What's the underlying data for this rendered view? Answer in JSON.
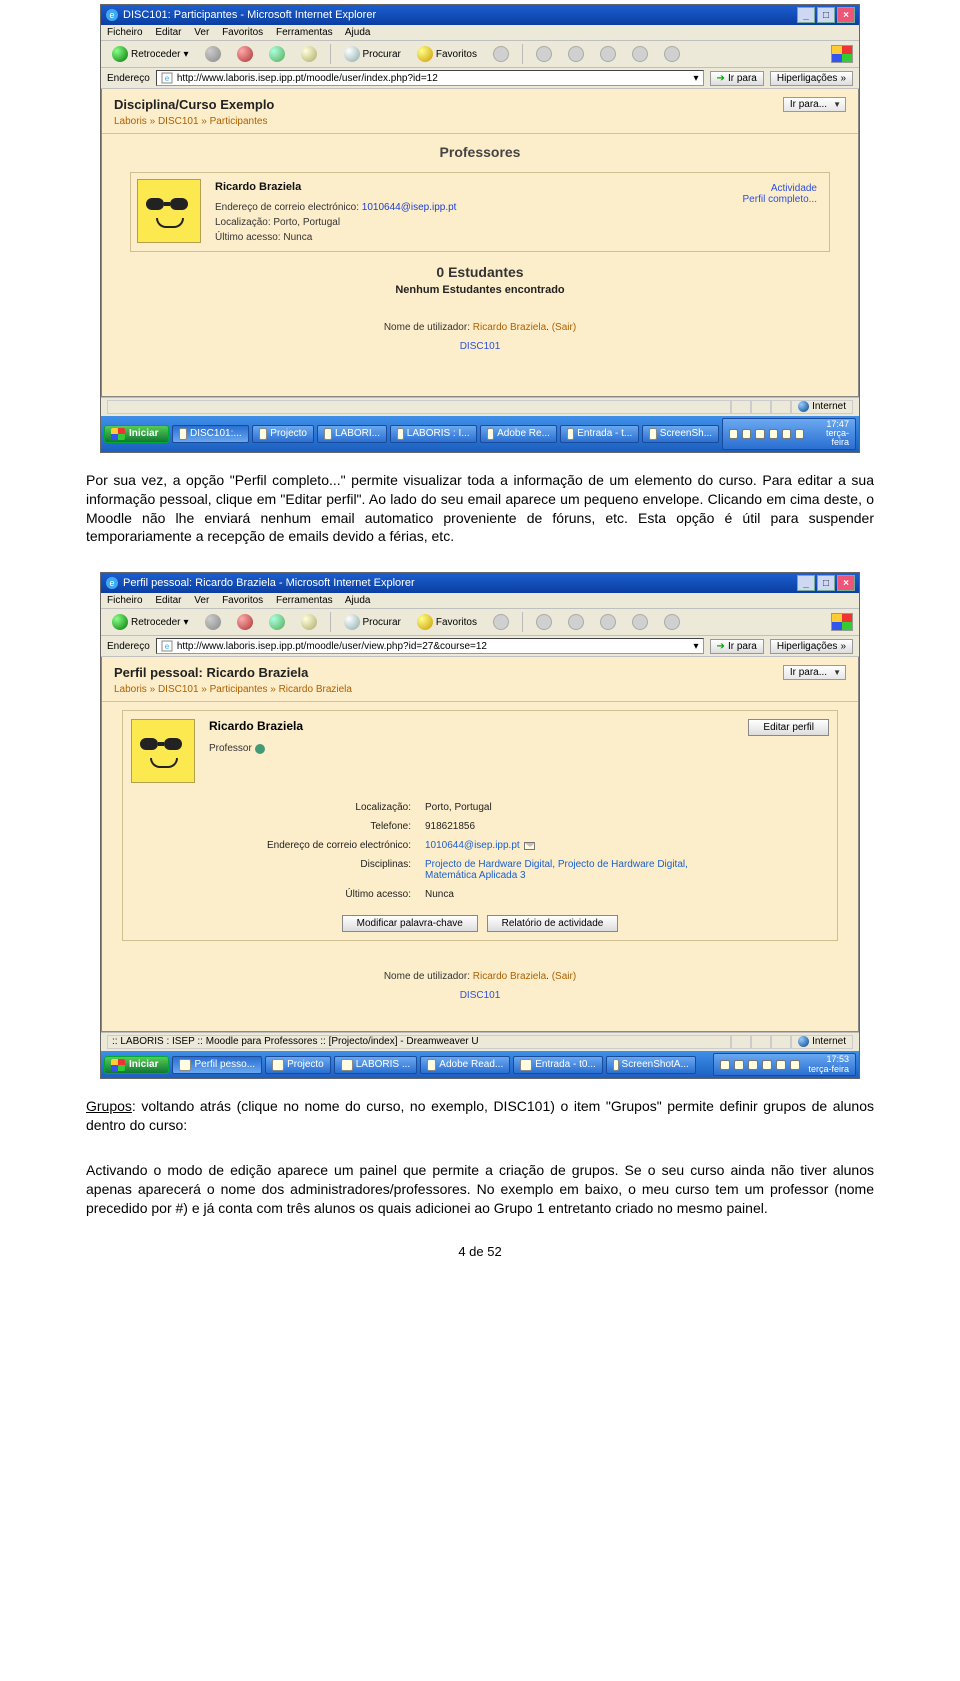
{
  "page_number": "4 de 52",
  "para1": "Por sua vez, a opção \"Perfil completo...\" permite visualizar toda a informação de um elemento do curso. Para editar a sua informação pessoal, clique em \"Editar perfil\". Ao lado do seu email aparece um pequeno envelope. Clicando em cima deste, o Moodle não lhe enviará nenhum email automatico proveniente de fóruns, etc. Esta opção é útil para suspender temporariamente a recepção de emails devido a férias, etc.",
  "grupos_label": "Grupos",
  "para2_rest": ": voltando atrás (clique no nome do curso, no exemplo, DISC101) o item \"Grupos\" permite definir grupos de alunos dentro do curso:",
  "para3": "Activando o modo de edição aparece um painel que permite a criação de grupos. Se o seu curso ainda não tiver alunos apenas aparecerá o nome dos administradores/professores. No exemplo em baixo, o meu curso tem um professor (nome precedido por #) e já conta com três alunos os quais adicionei ao Grupo 1 entretanto criado no mesmo painel.",
  "ie_menu": {
    "ficheiro": "Ficheiro",
    "editar": "Editar",
    "ver": "Ver",
    "favoritos": "Favoritos",
    "ferramentas": "Ferramentas",
    "ajuda": "Ajuda"
  },
  "ie_toolbar": {
    "back": "Retroceder",
    "search": "Procurar",
    "fav": "Favoritos"
  },
  "ie_addr_label": "Endereço",
  "ie_go": "Ir para",
  "ie_links": "Hiperligações",
  "ie_status_internet": "Internet",
  "start_label": "Iniciar",
  "shot1": {
    "title": "DISC101: Participantes - Microsoft Internet Explorer",
    "url": "http://www.laboris.isep.ipp.pt/moodle/user/index.php?id=12",
    "page_heading": "Disciplina/Curso Exemplo",
    "jump": "Ir para...",
    "breadcrumb": {
      "root": "Laboris",
      "course": "DISC101",
      "leaf": "Participantes"
    },
    "sec_teachers": "Professores",
    "teacher": {
      "name": "Ricardo Braziela",
      "email_label": "Endereço de correio electrónico:",
      "email": "1010644@isep.ipp.pt",
      "loc_label": "Localização:",
      "loc": "Porto, Portugal",
      "last_label": "Último acesso:",
      "last": "Nunca",
      "link_activity": "Actividade",
      "link_profile": "Perfil completo..."
    },
    "sec_students": "0 Estudantes",
    "none": "Nenhum Estudantes encontrado",
    "footer_user_label": "Nome de utilizador:",
    "footer_user": "Ricardo Braziela",
    "footer_logout": "(Sair)",
    "footer_course": "DISC101",
    "tasks": [
      "DISC101:...",
      "Projecto",
      "LABORI...",
      "LABORIS : I...",
      "Adobe Re...",
      "Entrada - t...",
      "ScreenSh..."
    ],
    "clock_time": "17:47",
    "clock_day": "terça-feira"
  },
  "shot2": {
    "title": "Perfil pessoal: Ricardo Braziela - Microsoft Internet Explorer",
    "url": "http://www.laboris.isep.ipp.pt/moodle/user/view.php?id=27&course=12",
    "page_heading": "Perfil pessoal: Ricardo Braziela",
    "jump": "Ir para...",
    "breadcrumb": {
      "root": "Laboris",
      "course": "DISC101",
      "p": "Participantes",
      "leaf": "Ricardo Braziela"
    },
    "name": "Ricardo Braziela",
    "role": "Professor",
    "edit_btn": "Editar perfil",
    "rows": {
      "loc_l": "Localização:",
      "loc_v": "Porto, Portugal",
      "tel_l": "Telefone:",
      "tel_v": "918621856",
      "mail_l": "Endereço de correio electrónico:",
      "mail_v": "1010644@isep.ipp.pt",
      "disc_l": "Disciplinas:",
      "disc_v": "Projecto de Hardware Digital, Projecto de Hardware Digital, Matemática Aplicada 3",
      "last_l": "Último acesso:",
      "last_v": "Nunca"
    },
    "btn_pwd": "Modificar palavra-chave",
    "btn_report": "Relatório de actividade",
    "footer_user_label": "Nome de utilizador:",
    "footer_user": "Ricardo Braziela",
    "footer_logout": "(Sair)",
    "footer_course": "DISC101",
    "status_left": ":: LABORIS : ISEP :: Moodle para Professores :: [Projecto/index] - Dreamweaver U",
    "tasks": [
      "Perfil pesso...",
      "Projecto",
      "LABORIS ...",
      "Adobe Read...",
      "Entrada - t0...",
      "ScreenShotA..."
    ],
    "clock_time": "17:53",
    "clock_day": "terça-feira"
  }
}
